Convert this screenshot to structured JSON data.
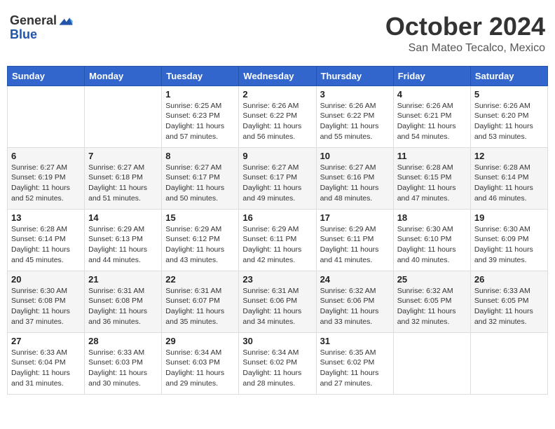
{
  "header": {
    "logo_general": "General",
    "logo_blue": "Blue",
    "month_title": "October 2024",
    "subtitle": "San Mateo Tecalco, Mexico"
  },
  "days_of_week": [
    "Sunday",
    "Monday",
    "Tuesday",
    "Wednesday",
    "Thursday",
    "Friday",
    "Saturday"
  ],
  "weeks": [
    [
      {
        "day": "",
        "sunrise": "",
        "sunset": "",
        "daylight": ""
      },
      {
        "day": "",
        "sunrise": "",
        "sunset": "",
        "daylight": ""
      },
      {
        "day": "1",
        "sunrise": "Sunrise: 6:25 AM",
        "sunset": "Sunset: 6:23 PM",
        "daylight": "Daylight: 11 hours and 57 minutes."
      },
      {
        "day": "2",
        "sunrise": "Sunrise: 6:26 AM",
        "sunset": "Sunset: 6:22 PM",
        "daylight": "Daylight: 11 hours and 56 minutes."
      },
      {
        "day": "3",
        "sunrise": "Sunrise: 6:26 AM",
        "sunset": "Sunset: 6:22 PM",
        "daylight": "Daylight: 11 hours and 55 minutes."
      },
      {
        "day": "4",
        "sunrise": "Sunrise: 6:26 AM",
        "sunset": "Sunset: 6:21 PM",
        "daylight": "Daylight: 11 hours and 54 minutes."
      },
      {
        "day": "5",
        "sunrise": "Sunrise: 6:26 AM",
        "sunset": "Sunset: 6:20 PM",
        "daylight": "Daylight: 11 hours and 53 minutes."
      }
    ],
    [
      {
        "day": "6",
        "sunrise": "Sunrise: 6:27 AM",
        "sunset": "Sunset: 6:19 PM",
        "daylight": "Daylight: 11 hours and 52 minutes."
      },
      {
        "day": "7",
        "sunrise": "Sunrise: 6:27 AM",
        "sunset": "Sunset: 6:18 PM",
        "daylight": "Daylight: 11 hours and 51 minutes."
      },
      {
        "day": "8",
        "sunrise": "Sunrise: 6:27 AM",
        "sunset": "Sunset: 6:17 PM",
        "daylight": "Daylight: 11 hours and 50 minutes."
      },
      {
        "day": "9",
        "sunrise": "Sunrise: 6:27 AM",
        "sunset": "Sunset: 6:17 PM",
        "daylight": "Daylight: 11 hours and 49 minutes."
      },
      {
        "day": "10",
        "sunrise": "Sunrise: 6:27 AM",
        "sunset": "Sunset: 6:16 PM",
        "daylight": "Daylight: 11 hours and 48 minutes."
      },
      {
        "day": "11",
        "sunrise": "Sunrise: 6:28 AM",
        "sunset": "Sunset: 6:15 PM",
        "daylight": "Daylight: 11 hours and 47 minutes."
      },
      {
        "day": "12",
        "sunrise": "Sunrise: 6:28 AM",
        "sunset": "Sunset: 6:14 PM",
        "daylight": "Daylight: 11 hours and 46 minutes."
      }
    ],
    [
      {
        "day": "13",
        "sunrise": "Sunrise: 6:28 AM",
        "sunset": "Sunset: 6:14 PM",
        "daylight": "Daylight: 11 hours and 45 minutes."
      },
      {
        "day": "14",
        "sunrise": "Sunrise: 6:29 AM",
        "sunset": "Sunset: 6:13 PM",
        "daylight": "Daylight: 11 hours and 44 minutes."
      },
      {
        "day": "15",
        "sunrise": "Sunrise: 6:29 AM",
        "sunset": "Sunset: 6:12 PM",
        "daylight": "Daylight: 11 hours and 43 minutes."
      },
      {
        "day": "16",
        "sunrise": "Sunrise: 6:29 AM",
        "sunset": "Sunset: 6:11 PM",
        "daylight": "Daylight: 11 hours and 42 minutes."
      },
      {
        "day": "17",
        "sunrise": "Sunrise: 6:29 AM",
        "sunset": "Sunset: 6:11 PM",
        "daylight": "Daylight: 11 hours and 41 minutes."
      },
      {
        "day": "18",
        "sunrise": "Sunrise: 6:30 AM",
        "sunset": "Sunset: 6:10 PM",
        "daylight": "Daylight: 11 hours and 40 minutes."
      },
      {
        "day": "19",
        "sunrise": "Sunrise: 6:30 AM",
        "sunset": "Sunset: 6:09 PM",
        "daylight": "Daylight: 11 hours and 39 minutes."
      }
    ],
    [
      {
        "day": "20",
        "sunrise": "Sunrise: 6:30 AM",
        "sunset": "Sunset: 6:08 PM",
        "daylight": "Daylight: 11 hours and 37 minutes."
      },
      {
        "day": "21",
        "sunrise": "Sunrise: 6:31 AM",
        "sunset": "Sunset: 6:08 PM",
        "daylight": "Daylight: 11 hours and 36 minutes."
      },
      {
        "day": "22",
        "sunrise": "Sunrise: 6:31 AM",
        "sunset": "Sunset: 6:07 PM",
        "daylight": "Daylight: 11 hours and 35 minutes."
      },
      {
        "day": "23",
        "sunrise": "Sunrise: 6:31 AM",
        "sunset": "Sunset: 6:06 PM",
        "daylight": "Daylight: 11 hours and 34 minutes."
      },
      {
        "day": "24",
        "sunrise": "Sunrise: 6:32 AM",
        "sunset": "Sunset: 6:06 PM",
        "daylight": "Daylight: 11 hours and 33 minutes."
      },
      {
        "day": "25",
        "sunrise": "Sunrise: 6:32 AM",
        "sunset": "Sunset: 6:05 PM",
        "daylight": "Daylight: 11 hours and 32 minutes."
      },
      {
        "day": "26",
        "sunrise": "Sunrise: 6:33 AM",
        "sunset": "Sunset: 6:05 PM",
        "daylight": "Daylight: 11 hours and 32 minutes."
      }
    ],
    [
      {
        "day": "27",
        "sunrise": "Sunrise: 6:33 AM",
        "sunset": "Sunset: 6:04 PM",
        "daylight": "Daylight: 11 hours and 31 minutes."
      },
      {
        "day": "28",
        "sunrise": "Sunrise: 6:33 AM",
        "sunset": "Sunset: 6:03 PM",
        "daylight": "Daylight: 11 hours and 30 minutes."
      },
      {
        "day": "29",
        "sunrise": "Sunrise: 6:34 AM",
        "sunset": "Sunset: 6:03 PM",
        "daylight": "Daylight: 11 hours and 29 minutes."
      },
      {
        "day": "30",
        "sunrise": "Sunrise: 6:34 AM",
        "sunset": "Sunset: 6:02 PM",
        "daylight": "Daylight: 11 hours and 28 minutes."
      },
      {
        "day": "31",
        "sunrise": "Sunrise: 6:35 AM",
        "sunset": "Sunset: 6:02 PM",
        "daylight": "Daylight: 11 hours and 27 minutes."
      },
      {
        "day": "",
        "sunrise": "",
        "sunset": "",
        "daylight": ""
      },
      {
        "day": "",
        "sunrise": "",
        "sunset": "",
        "daylight": ""
      }
    ]
  ]
}
